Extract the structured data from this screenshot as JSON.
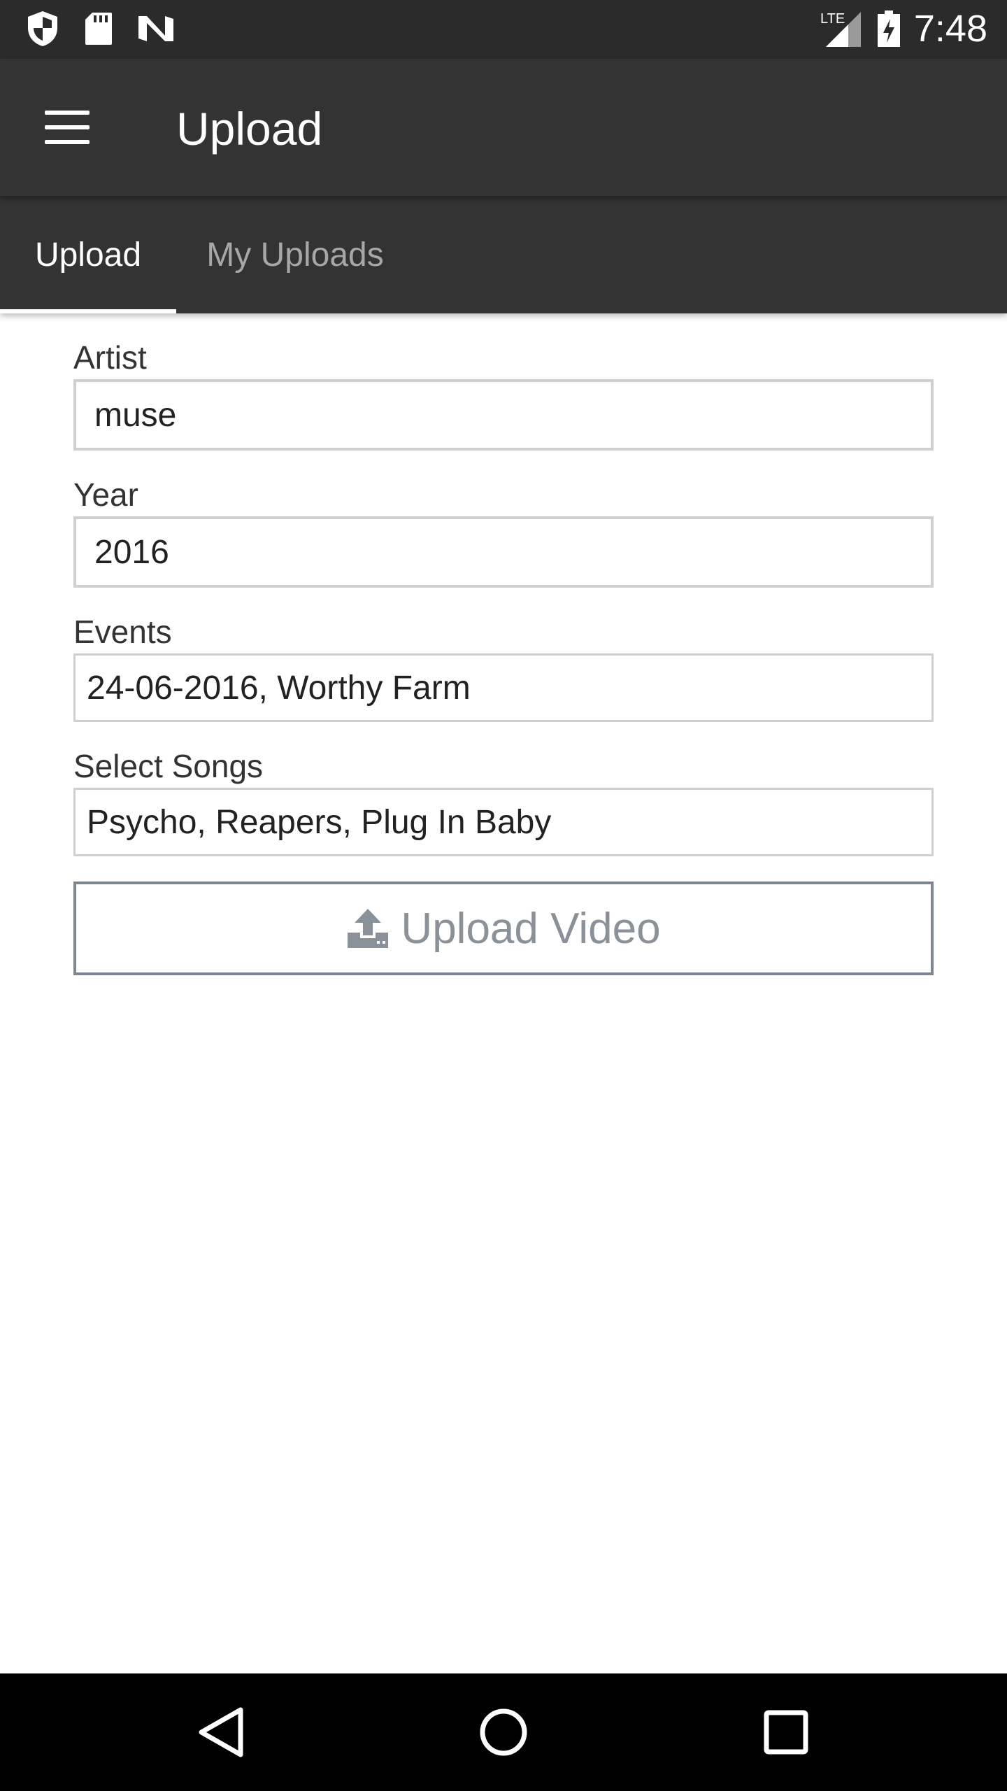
{
  "status_bar": {
    "time": "7:48",
    "network": "LTE",
    "left_icons": [
      "shield-icon",
      "sd-card-icon",
      "n-logo-icon"
    ],
    "right_icons": [
      "signal-icon",
      "battery-icon"
    ]
  },
  "app_bar": {
    "title": "Upload",
    "menu_icon": "hamburger-menu-icon"
  },
  "tabs": [
    {
      "label": "Upload",
      "selected": true
    },
    {
      "label": "My Uploads",
      "selected": false
    }
  ],
  "form": {
    "artist": {
      "label": "Artist",
      "value": "muse"
    },
    "year": {
      "label": "Year",
      "value": "2016"
    },
    "events": {
      "label": "Events",
      "value": "24-06-2016, Worthy Farm"
    },
    "songs": {
      "label": "Select Songs",
      "value": "Psycho, Reapers, Plug In Baby"
    },
    "upload_button": {
      "label": "Upload Video",
      "icon": "upload-icon"
    }
  },
  "nav_bar": {
    "buttons": [
      "back-icon",
      "home-icon",
      "recents-icon"
    ]
  },
  "colors": {
    "status_bar": "#2b2b2b",
    "app_bar": "#333333",
    "tab_inactive": "#a7a7a7",
    "button_text": "#8a9199"
  }
}
